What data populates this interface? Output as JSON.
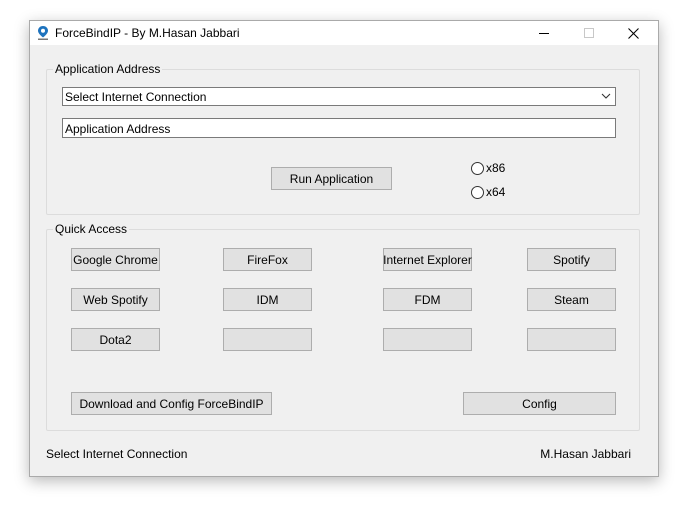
{
  "window": {
    "title": "ForceBindIP - By M.Hasan Jabbari",
    "controls": [
      "minimize-icon",
      "maximize-icon",
      "close-icon"
    ]
  },
  "application_group": {
    "label": "Application Address",
    "connection_select": {
      "value": "Select Internet Connection"
    },
    "address_field": {
      "value": "Application Address"
    },
    "run_button": "Run Application",
    "radio_x86": "x86",
    "radio_x64": "x64"
  },
  "quick_access": {
    "label": "Quick Access",
    "buttons": [
      "Google Chrome",
      "FireFox",
      "Internet Explorer",
      "Spotify",
      "Web Spotify",
      "IDM",
      "FDM",
      "Steam",
      "Dota2",
      "",
      "",
      ""
    ],
    "download_button": "Download and Config ForceBindIP",
    "config_button": "Config"
  },
  "status_bar": {
    "left": "Select Internet Connection",
    "right": "M.Hasan Jabbari"
  },
  "colors": {
    "window_bg": "#f0f0f0",
    "button_bg": "#e1e1e1",
    "button_border": "#adadad",
    "icon_blue": "#1e73be"
  }
}
